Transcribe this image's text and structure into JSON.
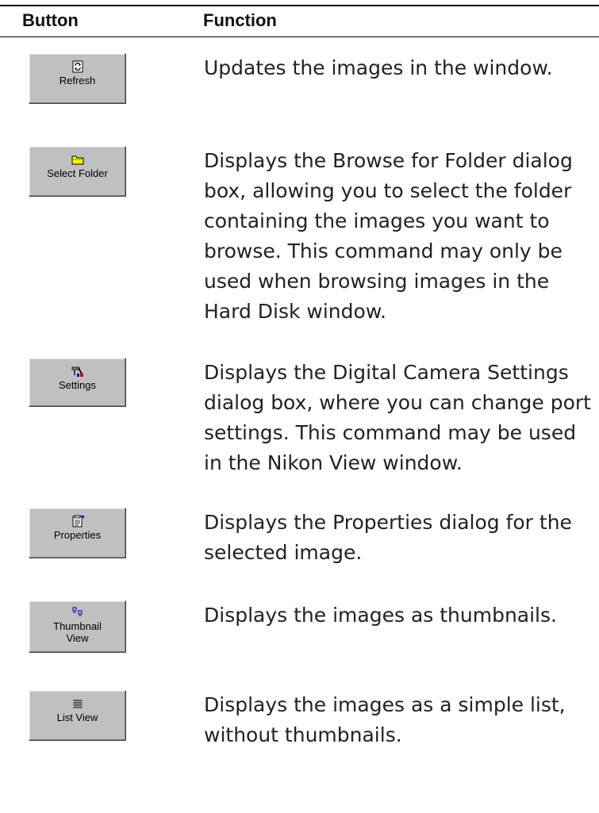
{
  "header": {
    "button_col": "Button",
    "function_col": "Function"
  },
  "rows": [
    {
      "button_label": "Refresh",
      "icon": "refresh-icon",
      "description": "Updates the images in the window."
    },
    {
      "button_label": "Select Folder",
      "icon": "folder-icon",
      "description": "Displays the Browse for Folder dialog box, allowing you to select the folder containing the images you want to browse.  This command may only be used when browsing images in the Hard Disk window."
    },
    {
      "button_label": "Settings",
      "icon": "settings-icon",
      "description": "Displays the Digital Camera Settings dialog box, where you can change port settings.  This command may be used in the Nikon View window."
    },
    {
      "button_label": "Properties",
      "icon": "properties-icon",
      "description": "Displays the Properties dialog for the selected image."
    },
    {
      "button_label": "Thumbnail View",
      "icon": "thumbnail-view-icon",
      "description": "Displays the images as thumbnails."
    },
    {
      "button_label": "List View",
      "icon": "list-view-icon",
      "description": "Displays the images as a simple list, without thumbnails."
    }
  ],
  "colors": {
    "button_face": "#c0c0c0",
    "folder_yellow": "#ffff00",
    "icon_blue": "#0000cc"
  }
}
